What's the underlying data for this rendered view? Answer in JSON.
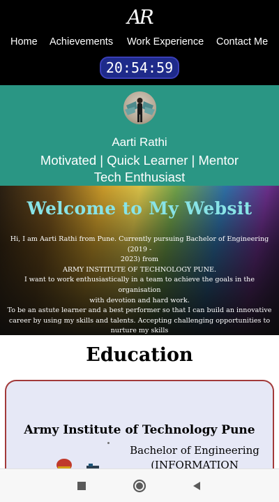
{
  "header": {
    "logo_text": "AR",
    "nav": [
      "Home",
      "Achievements",
      "Work Experience",
      "Contact Me"
    ],
    "clock": "20:54:59"
  },
  "profile": {
    "name": "Aarti Rathi",
    "tagline": "Motivated | Quick Learner | Mentor",
    "tagline2": "Tech Enthusiast"
  },
  "welcome": {
    "title": "Welcome to My Websit",
    "intro_lines": [
      "Hi, I am Aarti Rathi from Pune. Currently pursuing Bachelor of Engineering (2019 -",
      "2023) from",
      "ARMY INSTITUTE OF TECHNOLOGY PUNE.",
      "I want to work enthusiastically in a team to achieve the goals in the organisation",
      "with devotion and hard work.",
      "To be an astute learner and a best performer so that I can build an innovative",
      "career by using my skills and talents. Accepting challenging opportunities to",
      "nurture my skills"
    ]
  },
  "education": {
    "heading": "Education",
    "institute": "Army Institute of Technology Pune",
    "degree_line1": "Bachelor of Engineering",
    "degree_line2": "(INFORMATION"
  },
  "colors": {
    "header_bg": "#000000",
    "profile_bg": "#2a9684",
    "clock_bg": "#1e2a8a",
    "welcome_title": "#88e3e6",
    "card_bg": "#e6e8f6",
    "card_border": "#a23a3a"
  },
  "system_nav": {
    "icons": [
      "recents-square-icon",
      "home-circle-icon",
      "back-triangle-icon"
    ]
  }
}
